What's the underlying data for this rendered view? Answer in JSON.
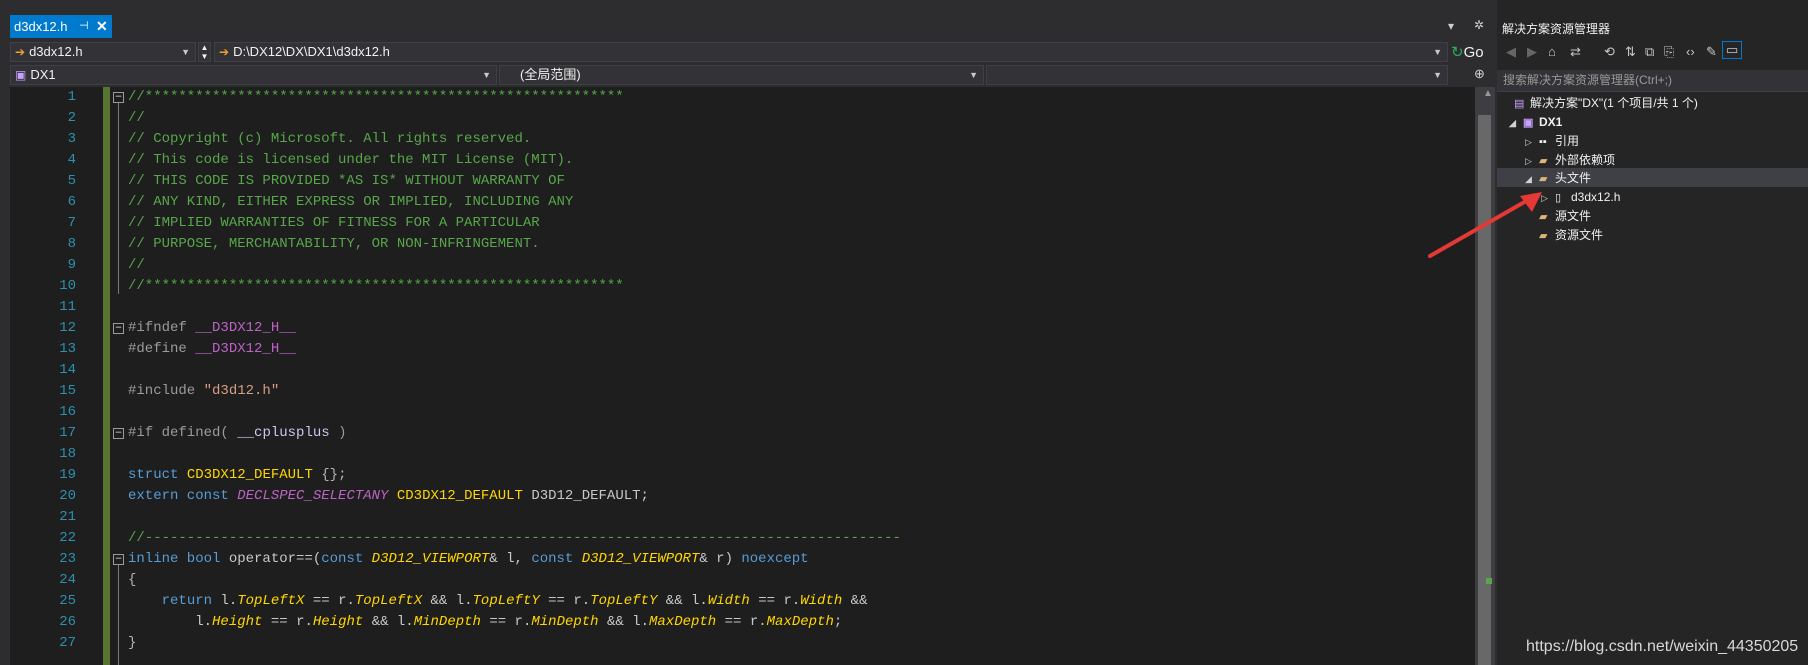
{
  "editor_tab": {
    "label": "d3dx12.h",
    "pin": "⊣",
    "close": "✕"
  },
  "tabstrip_controls": {
    "dropdown": "▾",
    "settings": "✲"
  },
  "nav": {
    "file_combo": "d3dx12.h",
    "path_combo": "D:\\DX12\\DX\\DX1\\d3dx12.h",
    "project_combo": "DX1",
    "scope_combo": "(全局范围)",
    "member_combo": "",
    "go_label": "Go"
  },
  "code_lines": [
    {
      "n": "1"
    },
    {
      "n": "2"
    },
    {
      "n": "3"
    },
    {
      "n": "4"
    },
    {
      "n": "5"
    },
    {
      "n": "6"
    },
    {
      "n": "7"
    },
    {
      "n": "8"
    },
    {
      "n": "9"
    },
    {
      "n": "10"
    },
    {
      "n": "11"
    },
    {
      "n": "12"
    },
    {
      "n": "13"
    },
    {
      "n": "14"
    },
    {
      "n": "15"
    },
    {
      "n": "16"
    },
    {
      "n": "17"
    },
    {
      "n": "18"
    },
    {
      "n": "19"
    },
    {
      "n": "20"
    },
    {
      "n": "21"
    },
    {
      "n": "22"
    },
    {
      "n": "23"
    },
    {
      "n": "24"
    },
    {
      "n": "25"
    },
    {
      "n": "26"
    },
    {
      "n": "27"
    }
  ],
  "code_text": {
    "l1": "//*********************************************************",
    "l2": "//",
    "l3": "// Copyright (c) Microsoft. All rights reserved.",
    "l4": "// This code is licensed under the MIT License (MIT).",
    "l5": "// THIS CODE IS PROVIDED *AS IS* WITHOUT WARRANTY OF",
    "l6": "// ANY KIND, EITHER EXPRESS OR IMPLIED, INCLUDING ANY",
    "l7": "// IMPLIED WARRANTIES OF FITNESS FOR A PARTICULAR",
    "l8": "// PURPOSE, MERCHANTABILITY, OR NON-INFRINGEMENT.",
    "l9": "//",
    "l10": "//*********************************************************",
    "l12a": "#ifndef",
    "l12b": "__D3DX12_H__",
    "l13a": "#define",
    "l13b": "__D3DX12_H__",
    "l15a": "#include",
    "l15b": "\"d3d12.h\"",
    "l17a": "#if defined(",
    "l17b": "__cplusplus",
    "l17c": ")",
    "l19a": "struct",
    "l19b": "CD3DX12_DEFAULT",
    "l19c": "{};",
    "l20a": "extern const",
    "l20b": "DECLSPEC_SELECTANY",
    "l20c": "CD3DX12_DEFAULT",
    "l20d": "D3D12_DEFAULT;",
    "l22": "//------------------------------------------------------------------------------------------",
    "l23a": "inline bool",
    "l23b": "operator==(",
    "l23c": "const",
    "l23d": "D3D12_VIEWPORT",
    "l23e": "& l,",
    "l23f": "const",
    "l23g": "D3D12_VIEWPORT",
    "l23h": "& r)",
    "l23i": "noexcept",
    "l24": "{",
    "l25a": "return",
    "l25b": "l.",
    "l25c": "TopLeftX",
    "l25d": "== r.",
    "l25e": "TopLeftX",
    "l25f": "&& l.",
    "l25g": "TopLeftY",
    "l25h": "== r.",
    "l25i": "TopLeftY",
    "l25j": "&& l.",
    "l25k": "Width",
    "l25l": "== r.",
    "l25m": "Width",
    "l25n": "&&",
    "l26a": "l.",
    "l26b": "Height",
    "l26c": "== r.",
    "l26d": "Height",
    "l26e": "&& l.",
    "l26f": "MinDepth",
    "l26g": "== r.",
    "l26h": "MinDepth",
    "l26i": "&& l.",
    "l26j": "MaxDepth",
    "l26k": "== r.",
    "l26l": "MaxDepth",
    "l26m": ";",
    "l27": "}"
  },
  "solution_explorer": {
    "title": "解决方案资源管理器",
    "search_placeholder": "搜索解决方案资源管理器(Ctrl+;)",
    "solution_label": "解决方案\"DX\"(1 个项目/共 1 个)",
    "project_label": "DX1",
    "items": [
      {
        "label": "引用"
      },
      {
        "label": "外部依赖项"
      },
      {
        "label": "头文件"
      },
      {
        "label": "d3dx12.h"
      },
      {
        "label": "源文件"
      },
      {
        "label": "资源文件"
      }
    ]
  },
  "watermark": "https://blog.csdn.net/weixin_44350205",
  "colors": {
    "accent": "#007acc",
    "annotation_arrow": "#e53935"
  }
}
